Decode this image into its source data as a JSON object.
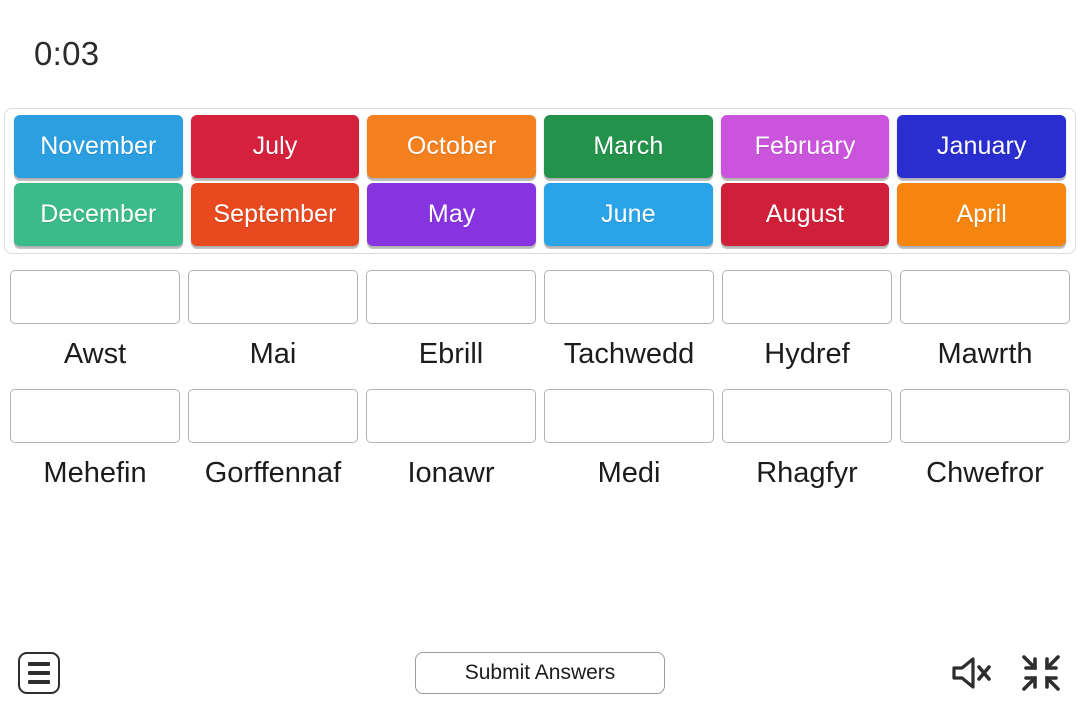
{
  "timer": "0:03",
  "tray": {
    "rows": [
      [
        {
          "label": "November",
          "color": "#2b9fe0"
        },
        {
          "label": "July",
          "color": "#d6213c"
        },
        {
          "label": "October",
          "color": "#f5801f"
        },
        {
          "label": "March",
          "color": "#23924a"
        },
        {
          "label": "February",
          "color": "#cb54dd"
        },
        {
          "label": "January",
          "color": "#2a2ed1"
        }
      ],
      [
        {
          "label": "December",
          "color": "#3cbb8a"
        },
        {
          "label": "September",
          "color": "#e8491f"
        },
        {
          "label": "May",
          "color": "#8833e0"
        },
        {
          "label": "June",
          "color": "#2ba3e8"
        },
        {
          "label": "August",
          "color": "#d01f39"
        },
        {
          "label": "April",
          "color": "#f5850f"
        }
      ]
    ]
  },
  "zones": {
    "rows": [
      [
        {
          "label": "Awst",
          "value": ""
        },
        {
          "label": "Mai",
          "value": ""
        },
        {
          "label": "Ebrill",
          "value": ""
        },
        {
          "label": "Tachwedd",
          "value": ""
        },
        {
          "label": "Hydref",
          "value": ""
        },
        {
          "label": "Mawrth",
          "value": ""
        }
      ],
      [
        {
          "label": "Mehefin",
          "value": ""
        },
        {
          "label": "Gorffennaf",
          "value": ""
        },
        {
          "label": "Ionawr",
          "value": ""
        },
        {
          "label": "Medi",
          "value": ""
        },
        {
          "label": "Rhagfyr",
          "value": ""
        },
        {
          "label": "Chwefror",
          "value": ""
        }
      ]
    ]
  },
  "footer": {
    "menu_icon": "hamburger-menu-icon",
    "submit_label": "Submit Answers",
    "sound_icon": "speaker-muted-icon",
    "fullscreen_icon": "exit-fullscreen-icon"
  },
  "colors": {
    "text": "#1c1c1c",
    "tray_border": "#dcdcdc",
    "dropbox_border": "#b4b4b4",
    "background": "#ffffff"
  }
}
